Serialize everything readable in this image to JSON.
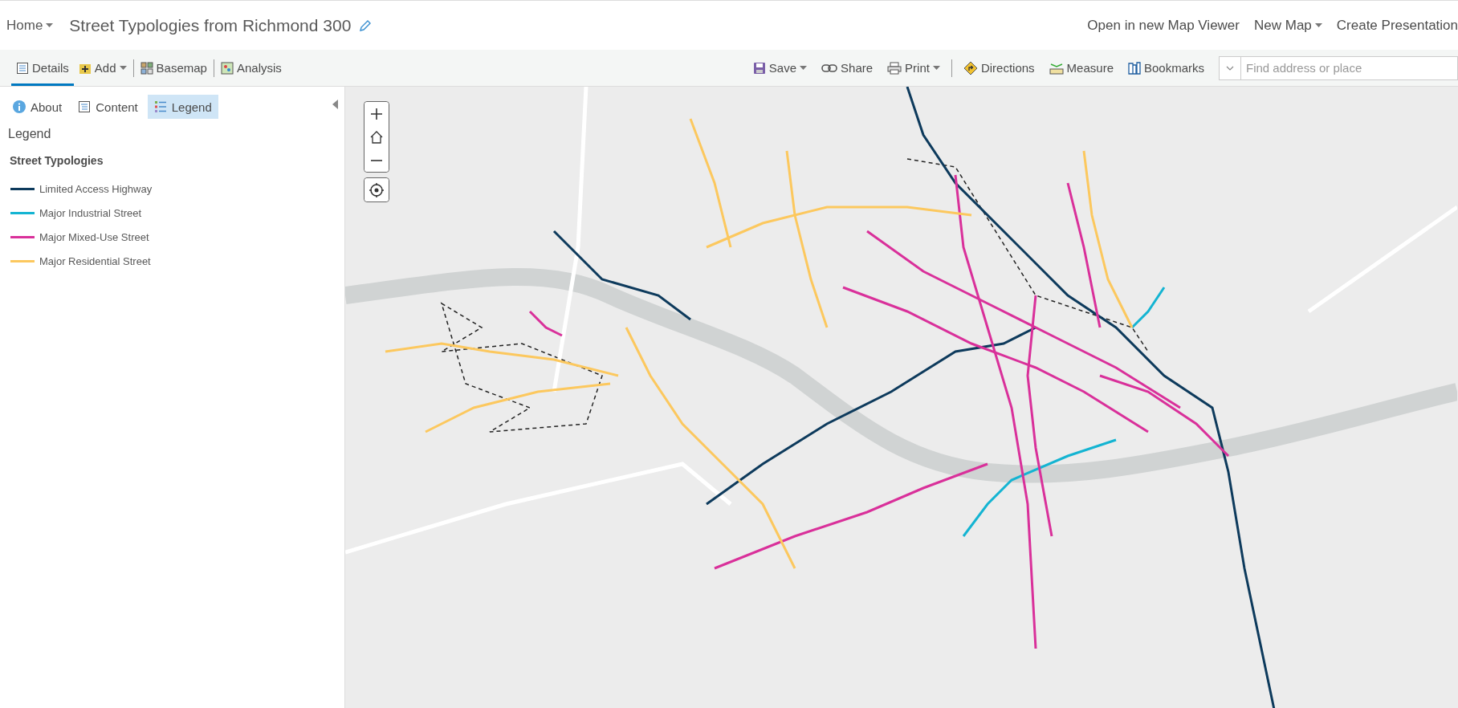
{
  "header": {
    "home": "Home",
    "title": "Street Typologies from Richmond 300",
    "links": [
      {
        "label": "Open in new Map Viewer",
        "dropdown": false
      },
      {
        "label": "New Map",
        "dropdown": true
      },
      {
        "label": "Create Presentation",
        "dropdown": false
      }
    ]
  },
  "toolbar": {
    "left": [
      {
        "label": "Details",
        "dropdown": false,
        "selected": true
      },
      {
        "label": "Add",
        "dropdown": true,
        "selected": false
      },
      {
        "label": "Basemap",
        "dropdown": false,
        "selected": false
      },
      {
        "label": "Analysis",
        "dropdown": false,
        "selected": false
      }
    ],
    "right": [
      {
        "label": "Save",
        "dropdown": true
      },
      {
        "label": "Share",
        "dropdown": false
      },
      {
        "label": "Print",
        "dropdown": true
      },
      {
        "label": "Directions",
        "dropdown": false
      },
      {
        "label": "Measure",
        "dropdown": false
      },
      {
        "label": "Bookmarks",
        "dropdown": false
      }
    ],
    "search": {
      "placeholder": "Find address or place"
    }
  },
  "panel": {
    "tabs": [
      {
        "label": "About",
        "selected": false
      },
      {
        "label": "Content",
        "selected": false
      },
      {
        "label": "Legend",
        "selected": true
      }
    ],
    "heading": "Legend",
    "layer": "Street Typologies",
    "legend": [
      {
        "label": "Limited Access Highway",
        "color": "#0d3a5c"
      },
      {
        "label": "Major Industrial Street",
        "color": "#14b4d2"
      },
      {
        "label": "Major Mixed-Use Street",
        "color": "#d9309a"
      },
      {
        "label": "Major Residential Street",
        "color": "#fcc85e"
      }
    ]
  }
}
